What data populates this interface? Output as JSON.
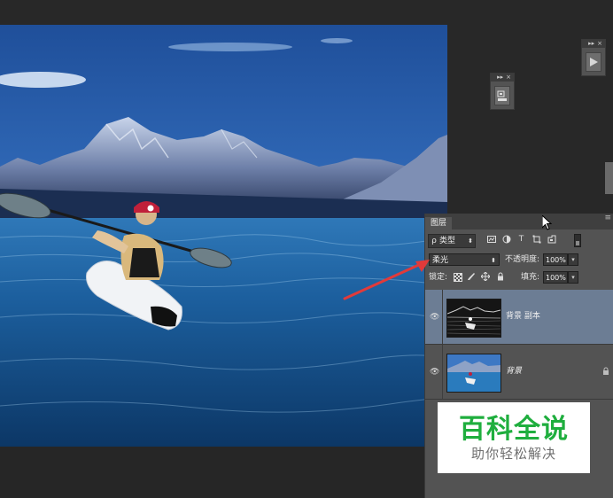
{
  "colors": {
    "workspace_bg": "#282828",
    "panel_bg": "#535353",
    "selected_layer": "#6c7d94",
    "annotation_arrow": "#e23a3a",
    "watermark_green": "#1fae3e"
  },
  "layers_panel": {
    "tab_label": "图层",
    "menu_icon": "panel-menu-icon",
    "filter": {
      "search_symbol": "ρ",
      "kind_label": "类型",
      "icons": [
        "image-filter-icon",
        "adjustment-filter-icon",
        "type-filter-icon",
        "shape-filter-icon",
        "smart-object-filter-icon"
      ],
      "type_glyph": "T"
    },
    "blend_mode": "柔光",
    "opacity_label": "不透明度:",
    "opacity_value": "100%",
    "lock_label": "锁定:",
    "fill_label": "填充:",
    "fill_value": "100%",
    "layers": [
      {
        "name": "背景 副本",
        "visible": true,
        "selected": true
      },
      {
        "name": "背景",
        "visible": true,
        "selected": false,
        "locked": true
      }
    ]
  },
  "floating_panels": {
    "top_right_icon": "play-icon",
    "middle_icon": "tool-preset-icon"
  },
  "watermark": {
    "title": "百科全说",
    "subtitle": "助你轻松解决"
  }
}
